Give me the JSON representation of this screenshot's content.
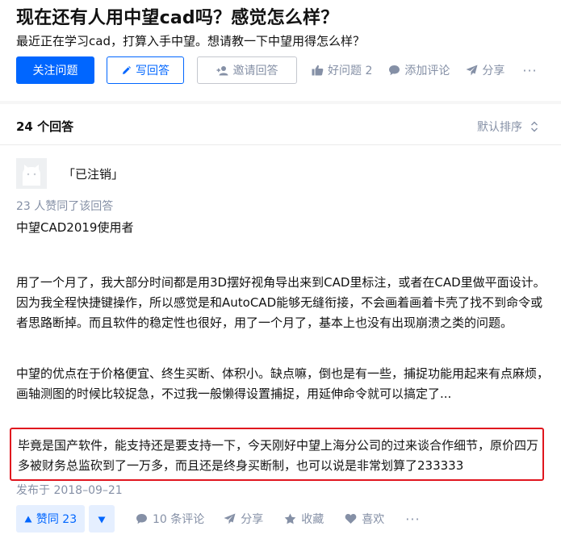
{
  "question": {
    "title": "现在还有人用中望cad吗？感觉怎么样？",
    "detail": "最近正在学习cad，打算入手中望。想请教一下中望用得怎么样？"
  },
  "actions": {
    "follow": "关注问题",
    "write": "写回答",
    "invite": "邀请回答",
    "good_question": "好问题 2",
    "comment": "添加评论",
    "share": "分享",
    "more": "···"
  },
  "answers_bar": {
    "count": "24 个回答",
    "sort": "默认排序"
  },
  "answer": {
    "author": "「已注销」",
    "voters": "23 人赞同了该回答",
    "paragraphs": [
      "中望CAD2019使用者",
      "用了一个月了，我大部分时间都是用3D摆好视角导出来到CAD里标注，或者在CAD里做平面设计。因为我全程快捷键操作，所以感觉是和AutoCAD能够无缝衔接，不会画着画着卡壳了找不到命令或者思路断掉。而且软件的稳定性也很好，用了一个月了，基本上也没有出现崩溃之类的问题。",
      "中望的优点在于价格便宜、终生买断、体积小。缺点嘛，倒也是有一些，捕捉功能用起来有点麻烦，画轴测图的时候比较捉急，不过我一般懒得设置捕捉，用延伸命令就可以搞定了...",
      "毕竟是国产软件，能支持还是要支持一下，今天刚好中望上海分公司的过来谈合作细节，原价四万多被财务总监砍到了一万多，而且还是终身买断制，也可以说是非常划算了233333"
    ],
    "published": "发布于 2018–09–21"
  },
  "footer": {
    "vote_up": "赞同 23",
    "comments": "10 条评论",
    "share": "分享",
    "collect": "收藏",
    "like": "喜欢",
    "more": "···"
  },
  "colors": {
    "brand": "#0066ff",
    "muted": "#8590a6",
    "highlight_border": "#e0161e"
  }
}
